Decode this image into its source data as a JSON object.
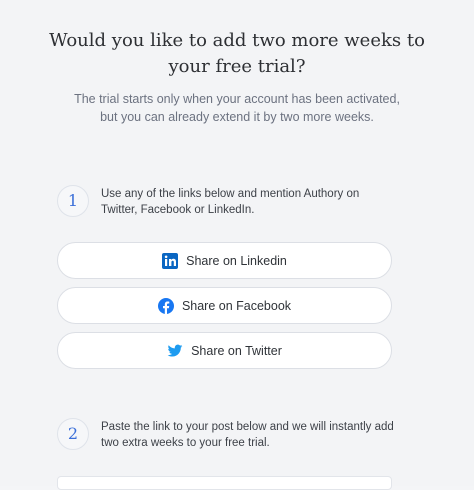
{
  "dialog": {
    "title": "Would you like to add two more weeks to your free trial?",
    "subtitle": "The trial starts only when your account has been activated, but you can already extend it by two more weeks."
  },
  "steps": [
    {
      "number": "1",
      "text": "Use any of the links below and mention Authory on Twitter, Facebook or LinkedIn."
    },
    {
      "number": "2",
      "text": "Paste the link to your post below and we will instantly add two extra weeks to your free trial."
    }
  ],
  "share_buttons": [
    {
      "label": "Share on Linkedin",
      "icon": "linkedin-icon",
      "color": "#0a66c2"
    },
    {
      "label": "Share on Facebook",
      "icon": "facebook-icon",
      "color": "#1877f2"
    },
    {
      "label": "Share on Twitter",
      "icon": "twitter-icon",
      "color": "#1d9bf0"
    }
  ],
  "colors": {
    "accent": "#3b6fd9",
    "background": "#f3f4f6"
  }
}
